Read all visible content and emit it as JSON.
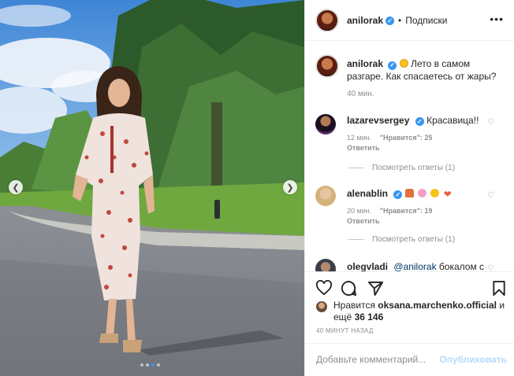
{
  "post": {
    "author": "anilorak",
    "follow_label": "Подписки",
    "more": "•••",
    "caption": "Лето в самом разгаре. Как спасаетесь от жары?",
    "caption_time": "40 мин."
  },
  "comments": [
    {
      "user": "lazarevsergey",
      "verified": true,
      "text": "Красавица!!",
      "time": "12 мин.",
      "likes": "\"Нравится\": 25",
      "reply": "Ответить",
      "view_replies": "Посмотреть ответы (1)"
    },
    {
      "user": "alenablin",
      "verified": true,
      "text": "",
      "time": "20 мин.",
      "likes": "\"Нравится\": 19",
      "reply": "Ответить",
      "view_replies": "Посмотреть ответы (1)"
    },
    {
      "user": "olegvladi",
      "verified": false,
      "mention": "@anilorak",
      "text": " бокалом с"
    }
  ],
  "likes": {
    "prefix": "Нравится ",
    "user": "oksana.marchenko.official",
    "suffix": " и ещё ",
    "count": "36 146"
  },
  "post_time": "40 МИНУТ НАЗАД",
  "add_comment": {
    "placeholder": "Добавьте комментарий...",
    "post_label": "Опубликовать"
  },
  "icons": {
    "verified": "verified-badge-icon",
    "like": "heart-icon",
    "comment": "comment-icon",
    "share": "share-icon",
    "save": "bookmark-icon",
    "prev": "chevron-left-icon",
    "next": "chevron-right-icon"
  },
  "colors": {
    "accent": "#3897f0",
    "muted": "#8e8e8e",
    "post_disabled": "#b3dbff"
  }
}
